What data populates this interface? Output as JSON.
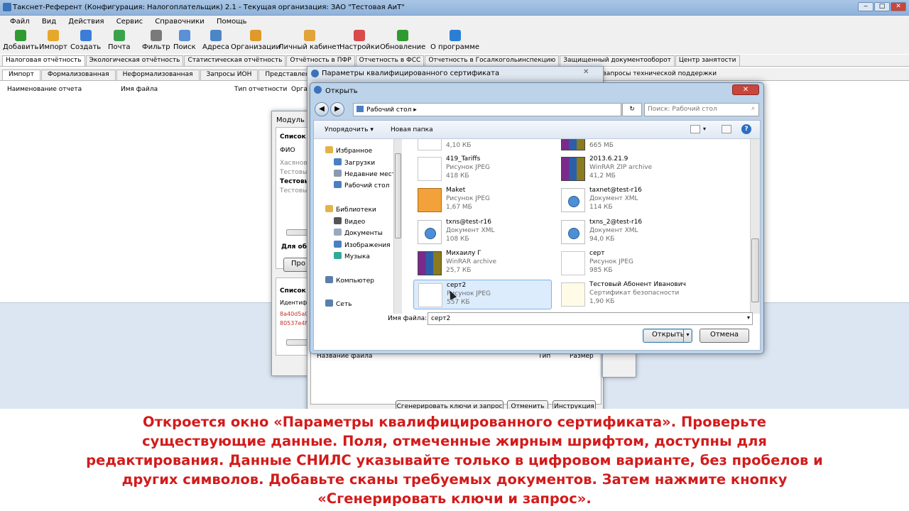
{
  "window": {
    "title": "Такснет-Референт (Конфигурация: Налогоплательщик) 2.1 - Текущая организация: ЗАО \"Тестовая АиТ\""
  },
  "menu": [
    "Файл",
    "Вид",
    "Действия",
    "Сервис",
    "Справочники",
    "Помощь"
  ],
  "toolbar": [
    {
      "label": "Добавить",
      "icon": "add-icon",
      "color": "#2f9a2f"
    },
    {
      "label": "Импорт",
      "icon": "import-icon",
      "color": "#e6a82a"
    },
    {
      "label": "Создать",
      "icon": "create-icon",
      "color": "#3b7dd8"
    },
    {
      "label": "Почта",
      "icon": "mail-icon",
      "color": "#3aa34a"
    },
    {
      "label": "Фильтр",
      "icon": "filter-icon",
      "color": "#7a7a7a"
    },
    {
      "label": "Поиск",
      "icon": "search-icon",
      "color": "#5b8fd6"
    },
    {
      "label": "Адреса",
      "icon": "addresses-icon",
      "color": "#4b86c6"
    },
    {
      "label": "Организации",
      "icon": "organizations-icon",
      "color": "#e09a2a"
    },
    {
      "label": "Личный кабинет",
      "icon": "personal-cabinet-icon",
      "color": "#e2a33a"
    },
    {
      "label": "Настройки",
      "icon": "settings-icon",
      "color": "#d94a4a"
    },
    {
      "label": "Обновление",
      "icon": "update-icon",
      "color": "#2f9a2f"
    },
    {
      "label": "О программе",
      "icon": "about-icon",
      "color": "#2a7fd4"
    }
  ],
  "main_tabs": [
    "Налоговая отчётность",
    "Экологическая отчётность",
    "Статистическая отчётность",
    "Отчётность в ПФР",
    "Отчетность в ФСС",
    "Отчетность в Госалкогольинспекцию",
    "Защищенный документооборот",
    "Центр занятости"
  ],
  "sub_tabs": [
    "Импорт",
    "Формализованная",
    "Неформализованная",
    "Запросы ИОН",
    "Представление докумен"
  ],
  "sub_tab_tail": "запросы технической поддержки",
  "columns": [
    "Наименование отчета",
    "Имя файла",
    "Тип отчетности",
    "Орга"
  ],
  "module_dialog": {
    "title": "Модуль с",
    "list_header": "Список",
    "fio_label": "ФИО",
    "rows": [
      "Хасянов",
      "Тестовы",
      "Тестовы",
      "Тестовы"
    ],
    "bold_label": "Для обб",
    "button": "Про",
    "list_header2": "Список",
    "ident_label": "Идентифи",
    "hash1": "8a40d5a0",
    "hash2": "80537e4f"
  },
  "cert_params_dialog": {
    "title": "Параметры квалифицированного сертификата",
    "col_name": "Название файла",
    "col_type": "Тип",
    "col_size": "Размер",
    "btn_generate": "Сгенерировать ключи и запрос",
    "btn_cancel": "Отменить",
    "btn_instructions": "Инструкция"
  },
  "open_dialog": {
    "title": "Открыть",
    "path": "Рабочий стол",
    "search_placeholder": "Поиск: Рабочий стол",
    "organize": "Упорядочить",
    "new_folder": "Новая папка",
    "nav": [
      {
        "label": "Избранное",
        "indent": false,
        "icon": "favorites-icon",
        "color": "#e3b34a"
      },
      {
        "label": "Загрузки",
        "indent": true,
        "icon": "downloads-icon",
        "color": "#4a7fc1"
      },
      {
        "label": "Недавние места",
        "indent": true,
        "icon": "recent-places-icon",
        "color": "#8a9aae"
      },
      {
        "label": "Рабочий стол",
        "indent": true,
        "icon": "desktop-icon",
        "color": "#4a7fc1"
      },
      {
        "label": "Библиотеки",
        "indent": false,
        "icon": "libraries-icon",
        "color": "#e3b34a"
      },
      {
        "label": "Видео",
        "indent": true,
        "icon": "video-icon",
        "color": "#555"
      },
      {
        "label": "Документы",
        "indent": true,
        "icon": "documents-icon",
        "color": "#9ab"
      },
      {
        "label": "Изображения",
        "indent": true,
        "icon": "images-icon",
        "color": "#4a7fc1"
      },
      {
        "label": "Музыка",
        "indent": true,
        "icon": "music-icon",
        "color": "#3a9"
      },
      {
        "label": "Компьютер",
        "indent": false,
        "icon": "computer-icon",
        "color": "#5a7fa8"
      },
      {
        "label": "Сеть",
        "indent": false,
        "icon": "network-icon",
        "color": "#5a7fa8"
      }
    ],
    "files_left": [
      {
        "name": "",
        "type": "",
        "size": "4,10 КБ",
        "icon": "ic-jpg"
      },
      {
        "name": "419_Tariffs",
        "type": "Рисунок JPEG",
        "size": "418 КБ",
        "icon": "ic-jpg"
      },
      {
        "name": "Maket",
        "type": "Рисунок JPEG",
        "size": "1,67 МБ",
        "icon": "ic-maket"
      },
      {
        "name": "txns@test-r16",
        "type": "Документ XML",
        "size": "108 КБ",
        "icon": "ic-xml"
      },
      {
        "name": "Михаилу Г",
        "type": "WinRAR archive",
        "size": "25,7 КБ",
        "icon": "ic-rar"
      },
      {
        "name": "серт2",
        "type": "Рисунок JPEG",
        "size": "557 КБ",
        "icon": "ic-jpg",
        "selected": true
      }
    ],
    "files_right": [
      {
        "name": "",
        "type": "",
        "size": "665 МБ",
        "icon": "ic-rar"
      },
      {
        "name": "2013.6.21.9",
        "type": "WinRAR ZIP archive",
        "size": "41,2 МБ",
        "icon": "ic-rar"
      },
      {
        "name": "taxnet@test-r16",
        "type": "Документ XML",
        "size": "114 КБ",
        "icon": "ic-xml"
      },
      {
        "name": "txns_2@test-r16",
        "type": "Документ XML",
        "size": "94,0 КБ",
        "icon": "ic-xml"
      },
      {
        "name": "серт",
        "type": "Рисунок JPEG",
        "size": "985 КБ",
        "icon": "ic-jpg"
      },
      {
        "name": "Тестовый Абонент Иванович",
        "type": "Сертификат безопасности",
        "size": "1,90 КБ",
        "icon": "ic-cert"
      }
    ],
    "filename_label": "Имя файла:",
    "filename_value": "серт2",
    "btn_open": "Открыть",
    "btn_cancel": "Отмена"
  },
  "caption": {
    "lines": [
      "Откроется окно «Параметры квалифицированного сертификата».  Проверьте",
      "существующие данные. Поля, отмеченные жирным шрифтом, доступны для",
      "редактирования. Данные СНИЛС указывайте только в цифровом варианте, без пробелов и",
      "других символов. Добавьте сканы требуемых документов. Затем нажмите кнопку",
      "«Сгенерировать ключи и запрос»."
    ],
    "color": "#d31b1b"
  }
}
